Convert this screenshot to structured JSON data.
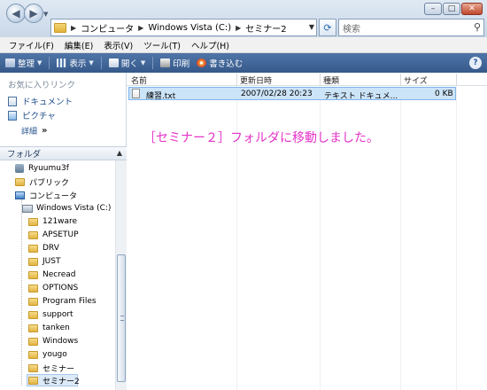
{
  "address": {
    "crumbs": [
      "コンピュータ",
      "Windows Vista (C:)",
      "セミナー2"
    ]
  },
  "search": {
    "placeholder": "検索"
  },
  "menu": [
    "ファイル(F)",
    "編集(E)",
    "表示(V)",
    "ツール(T)",
    "ヘルプ(H)"
  ],
  "toolbar": {
    "organize": "整理",
    "view": "表示",
    "open": "開く",
    "print": "印刷",
    "burn": "書き込む"
  },
  "favorites": {
    "title": "お気に入りリンク",
    "items": [
      "ドキュメント",
      "ピクチャ"
    ],
    "details_label": "詳細"
  },
  "folders": {
    "header": "フォルダ",
    "tree": [
      "Ryuumu3f",
      "パブリック",
      "コンピュータ",
      "Windows Vista (C:)",
      "121ware",
      "APSETUP",
      "DRV",
      "JUST",
      "Necread",
      "OPTIONS",
      "Program Files",
      "support",
      "tanken",
      "Windows",
      "yougo",
      "セミナー",
      "セミナー2"
    ]
  },
  "columns": [
    "名前",
    "更新日時",
    "種類",
    "サイズ"
  ],
  "files": [
    {
      "name": "練習.txt",
      "modified": "2007/02/28 20:23",
      "type": "テキスト ドキュメ...",
      "size": "0 KB"
    }
  ],
  "message": "［セミナー２］フォルダに移動しました。",
  "colors": {
    "message": "#e533c8",
    "toolbar": "#436a9c",
    "selection": "#cce4f8"
  }
}
